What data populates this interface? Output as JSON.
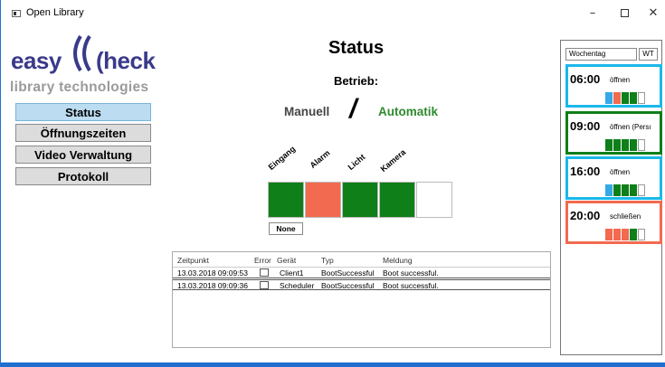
{
  "window": {
    "title": "Open Library",
    "min": "–",
    "close": "✕"
  },
  "logo": {
    "easy": "easy",
    "check": "(heck",
    "tagline": "library technologies"
  },
  "nav": [
    {
      "label": "Status",
      "active": true
    },
    {
      "label": "Öffnungszeiten",
      "active": false
    },
    {
      "label": "Video Verwaltung",
      "active": false
    },
    {
      "label": "Protokoll",
      "active": false
    }
  ],
  "status": {
    "title": "Status",
    "betrieb": "Betrieb:",
    "manuell": "Manuell",
    "slash": "/",
    "automatik": "Automatik"
  },
  "devices": [
    {
      "label": "Eingang",
      "color": "#0f7f1a"
    },
    {
      "label": "Alarm",
      "color": "#f26a4f"
    },
    {
      "label": "Licht",
      "color": "#0f7f1a"
    },
    {
      "label": "Kamera",
      "color": "#0f7f1a"
    },
    {
      "label": "",
      "color": "#ffffff"
    }
  ],
  "none_button": "None",
  "log": {
    "headers": [
      "Zeitpunkt",
      "Error",
      "Gerät",
      "Typ",
      "Meldung"
    ],
    "rows": [
      {
        "time": "13.03.2018 09:09:53",
        "error": false,
        "device": "Client1",
        "type": "BootSuccessful",
        "message": "Boot successful."
      },
      {
        "time": "13.03.2018 09:09:36",
        "error": false,
        "device": "Scheduler",
        "type": "BootSuccessful",
        "message": "Boot successful."
      }
    ]
  },
  "schedule": {
    "weekday_label": "Wochentag",
    "wt": "WT",
    "entries": [
      {
        "time": "06:00",
        "text": "öffnen",
        "border": "#1ab8ea"
      },
      {
        "time": "09:00",
        "text": "öffnen (Persı",
        "border": "#0f7f1a"
      },
      {
        "time": "16:00",
        "text": "öffnen",
        "border": "#1ab8ea"
      },
      {
        "time": "20:00",
        "text": "schließen",
        "border": "#f26a4f"
      }
    ]
  },
  "colors": {
    "green": "#0f7f1a",
    "red": "#f26a4f",
    "blue": "#35a8e8"
  }
}
